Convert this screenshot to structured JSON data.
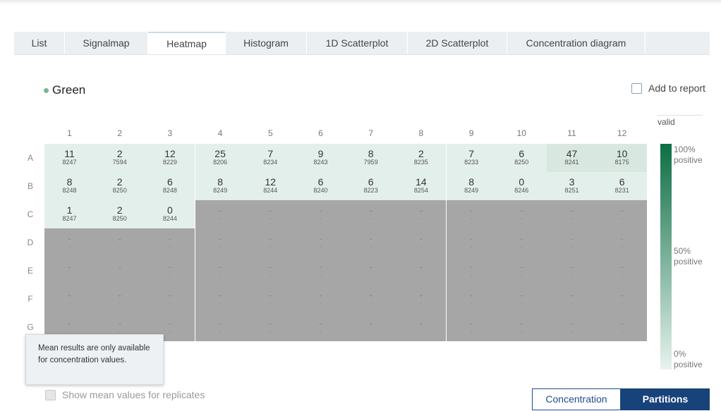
{
  "tabs": [
    "List",
    "Signalmap",
    "Heatmap",
    "Histogram",
    "1D Scatterplot",
    "2D Scatterplot",
    "Concentration diagram"
  ],
  "active_tab": "Heatmap",
  "dye": "Green",
  "add_to_report": "Add to report",
  "columns": [
    "1",
    "2",
    "3",
    "4",
    "5",
    "6",
    "7",
    "8",
    "9",
    "10",
    "11",
    "12"
  ],
  "rows": [
    "A",
    "B",
    "C",
    "D",
    "E",
    "F",
    "G"
  ],
  "wells": {
    "A": [
      [
        "11",
        "8247"
      ],
      [
        "2",
        "7594"
      ],
      [
        "12",
        "8229"
      ],
      [
        "25",
        "8206"
      ],
      [
        "7",
        "8234"
      ],
      [
        "9",
        "8243"
      ],
      [
        "8",
        "7959"
      ],
      [
        "2",
        "8235"
      ],
      [
        "7",
        "8233"
      ],
      [
        "6",
        "8250"
      ],
      [
        "47",
        "8241"
      ],
      [
        "10",
        "8175"
      ]
    ],
    "B": [
      [
        "8",
        "8248"
      ],
      [
        "2",
        "8250"
      ],
      [
        "6",
        "8248"
      ],
      [
        "8",
        "8249"
      ],
      [
        "12",
        "8244"
      ],
      [
        "6",
        "8240"
      ],
      [
        "6",
        "8223"
      ],
      [
        "14",
        "8254"
      ],
      [
        "8",
        "8249"
      ],
      [
        "0",
        "8246"
      ],
      [
        "3",
        "8251"
      ],
      [
        "6",
        "8231"
      ]
    ],
    "C": [
      [
        "1",
        "8247"
      ],
      [
        "2",
        "8250"
      ],
      [
        "0",
        "8244"
      ]
    ]
  },
  "empty_value": "-",
  "legend": {
    "title": "valid",
    "top": [
      "100%",
      "positive"
    ],
    "mid": [
      "50%",
      "positive"
    ],
    "bottom": [
      "0%",
      "positive"
    ],
    "colors": [
      "#0c6e45",
      "#e7f3ee"
    ]
  },
  "tooltip": "Mean results are only available for concentration values.",
  "show_mean": "Show mean values for replicates",
  "toggle": {
    "concentration": "Concentration",
    "partitions": "Partitions",
    "selected": "Partitions"
  }
}
